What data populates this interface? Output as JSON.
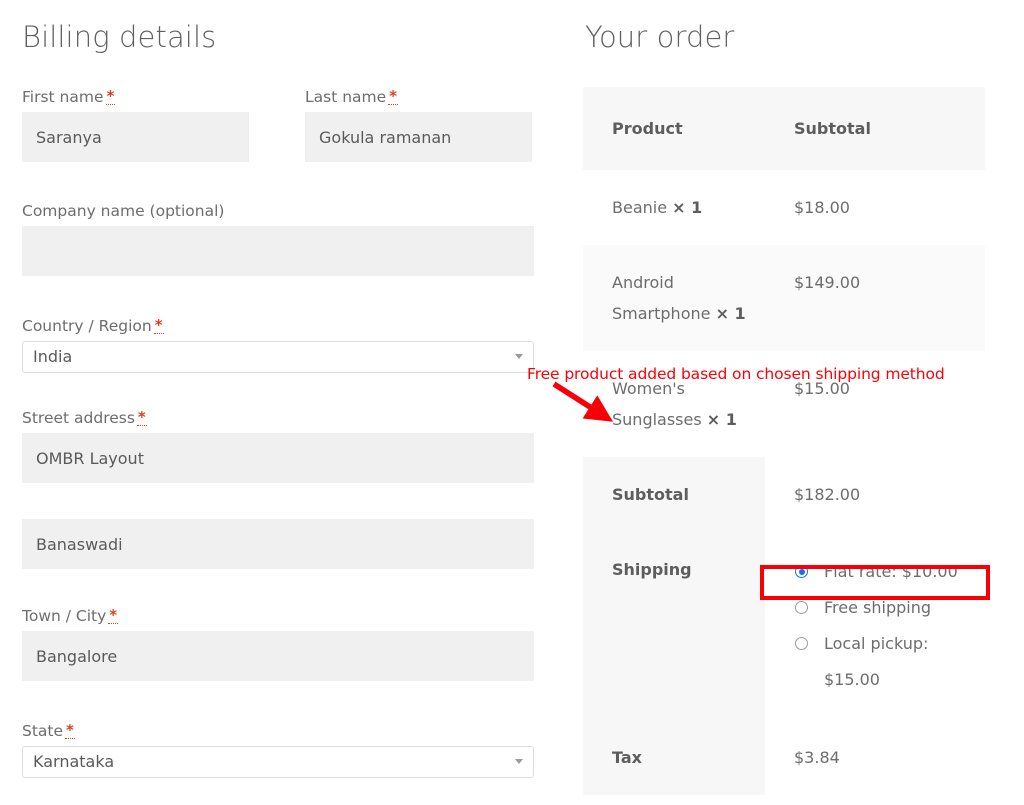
{
  "billing": {
    "title": "Billing details",
    "fields": {
      "first_name": {
        "label": "First name",
        "required_mark": "*",
        "value": "Saranya",
        "placeholder": ""
      },
      "last_name": {
        "label": "Last name",
        "required_mark": "*",
        "value": "Gokula ramanan",
        "placeholder": ""
      },
      "company": {
        "label": "Company name (optional)",
        "value": "",
        "placeholder": ""
      },
      "country": {
        "label": "Country / Region",
        "required_mark": "*",
        "value": "India"
      },
      "street_address": {
        "label": "Street address",
        "required_mark": "*",
        "value": "OMBR Layout",
        "placeholder": ""
      },
      "street_address_2": {
        "label": "",
        "value": "Banaswadi",
        "placeholder": ""
      },
      "town_city": {
        "label": "Town / City",
        "required_mark": "*",
        "value": "Bangalore",
        "placeholder": ""
      },
      "state": {
        "label": "State",
        "required_mark": "*",
        "value": "Karnataka"
      }
    }
  },
  "order": {
    "title": "Your order",
    "columns": {
      "product": "Product",
      "subtotal": "Subtotal"
    },
    "items": [
      {
        "name": "Beanie",
        "qty_text": "× 1",
        "subtotal": "$18.00"
      },
      {
        "name": "Android Smartphone",
        "qty_text": "× 1",
        "subtotal": "$149.00"
      },
      {
        "name": "Women's Sunglasses",
        "qty_text": "× 1",
        "subtotal": "$15.00"
      }
    ],
    "totals": {
      "subtotal_label": "Subtotal",
      "subtotal_value": "$182.00",
      "shipping_label": "Shipping",
      "tax_label": "Tax",
      "tax_value": "$3.84"
    },
    "shipping_methods": [
      {
        "label": "Flat rate: $10.00",
        "selected": true
      },
      {
        "label": "Free shipping",
        "selected": false
      },
      {
        "label": "Local pickup: $15.00",
        "selected": false
      }
    ]
  },
  "annotations": {
    "free_product_note": "Free product added based on chosen shipping method",
    "note_color": "#fb0007",
    "highlight_color": "#f80008"
  }
}
